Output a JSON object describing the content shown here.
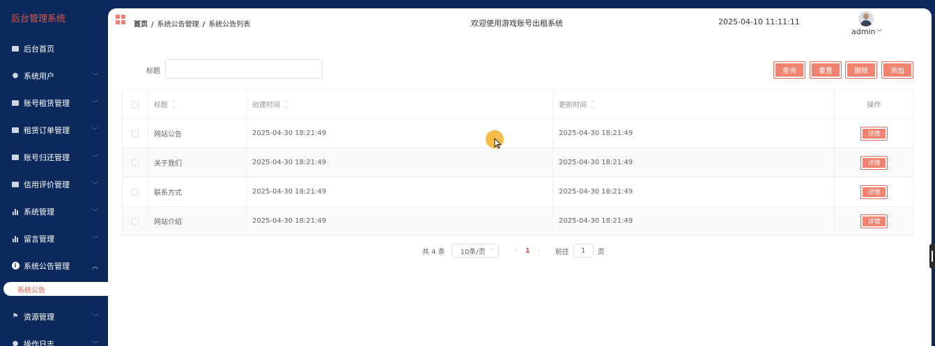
{
  "sidebar": {
    "brand": "后台管理系统",
    "items": [
      {
        "label": "后台首页",
        "icon": "monitor-icon"
      },
      {
        "label": "系统用户",
        "icon": "user-icon"
      },
      {
        "label": "账号租赁管理",
        "icon": "image-icon"
      },
      {
        "label": "租赁订单管理",
        "icon": "image-icon"
      },
      {
        "label": "账号归还管理",
        "icon": "image-icon"
      },
      {
        "label": "信用评价管理",
        "icon": "image-icon"
      },
      {
        "label": "系统管理",
        "icon": "bar-chart-icon"
      },
      {
        "label": "留言管理",
        "icon": "bar-chart-icon"
      },
      {
        "label": "系统公告管理",
        "icon": "info-icon"
      },
      {
        "label": "资源管理",
        "icon": "flag-icon"
      },
      {
        "label": "操作日志",
        "icon": "user-icon"
      }
    ],
    "active_sub": "系统公告"
  },
  "header": {
    "breadcrumb": [
      "首页",
      "系统公告管理",
      "系统公告列表"
    ],
    "breadcrumb_sep": "/",
    "welcome": "欢迎使用游戏账号出租系统",
    "datetime": "2025-04-10 11:11:11",
    "user": "admin"
  },
  "search": {
    "label": "标题",
    "value": ""
  },
  "actions": {
    "query": "查询",
    "reset": "重置",
    "delete": "删除",
    "add": "添加"
  },
  "table": {
    "headers": [
      "标题",
      "创建时间",
      "更新时间",
      "操作"
    ],
    "rows": [
      {
        "title": "网站公告",
        "created": "2025-04-30 18:21:49",
        "updated": "2025-04-30 18:21:49",
        "action": "详情"
      },
      {
        "title": "关于我们",
        "created": "2025-04-30 18:21:49",
        "updated": "2025-04-30 18:21:49",
        "action": "详情"
      },
      {
        "title": "联系方式",
        "created": "2025-04-30 18:21:49",
        "updated": "2025-04-30 18:21:49",
        "action": "详情"
      },
      {
        "title": "网站介绍",
        "created": "2025-04-30 18:21:49",
        "updated": "2025-04-30 18:21:49",
        "action": "详情"
      }
    ]
  },
  "pagination": {
    "total": "共 4 条",
    "page_size": "10条/页",
    "current_page": "1",
    "goto_prefix": "前往",
    "goto_value": "1",
    "goto_suffix": "页"
  },
  "colors": {
    "sidebar_bg": "#0b2a5b",
    "accent": "#f0826f",
    "brand": "#e0584c"
  }
}
